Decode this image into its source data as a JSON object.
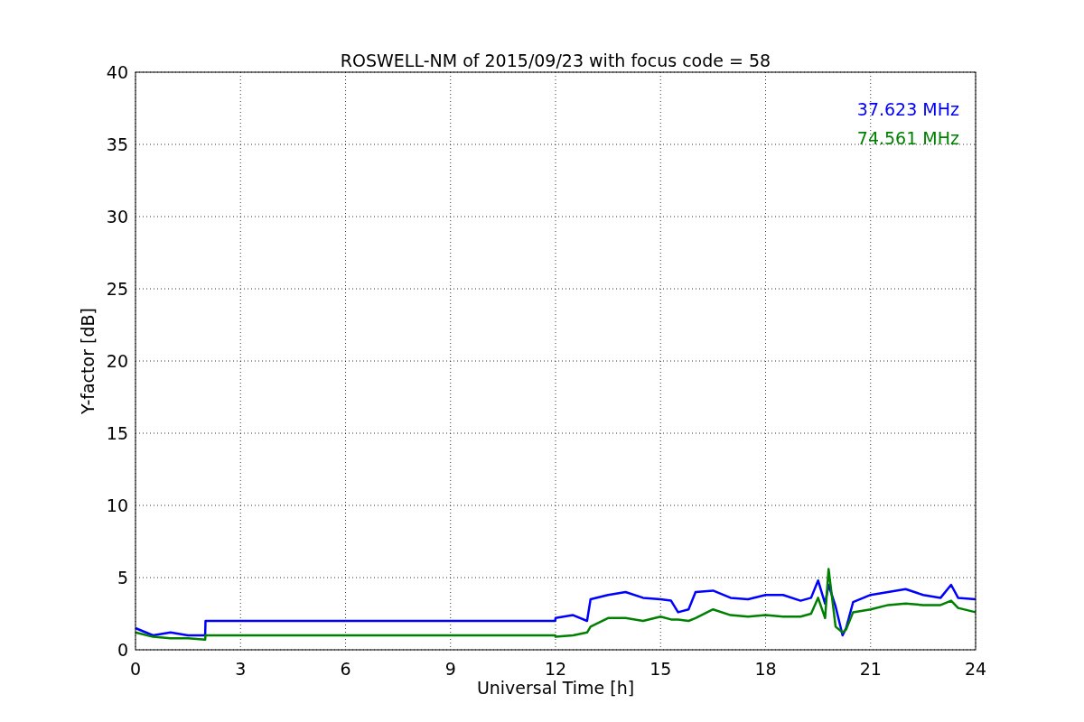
{
  "chart_data": {
    "type": "line",
    "title": "ROSWELL-NM of 2015/09/23 with focus code = 58",
    "xlabel": "Universal Time [h]",
    "ylabel": "Y-factor [dB]",
    "x": [
      0,
      0.5,
      1,
      1.5,
      1.99,
      2,
      6,
      11.99,
      12,
      12.5,
      12.9,
      13,
      13.5,
      14,
      14.5,
      15,
      15.3,
      15.5,
      15.8,
      16,
      16.5,
      17,
      17.5,
      18,
      18.5,
      19,
      19.3,
      19.5,
      19.7,
      19.8,
      20,
      20.2,
      20.3,
      20.5,
      21,
      21.5,
      22,
      22.5,
      23,
      23.3,
      23.5,
      24
    ],
    "series": [
      {
        "name": "37.623 MHz",
        "color": "#0000ff",
        "values": [
          1.5,
          1.0,
          1.2,
          1.0,
          1.0,
          2.0,
          2.0,
          2.0,
          2.2,
          2.4,
          2.0,
          3.5,
          3.8,
          4.0,
          3.6,
          3.5,
          3.4,
          2.6,
          2.8,
          4.0,
          4.1,
          3.6,
          3.5,
          3.8,
          3.8,
          3.4,
          3.6,
          4.8,
          3.2,
          4.5,
          3.0,
          1.0,
          1.5,
          3.3,
          3.8,
          4.0,
          4.2,
          3.8,
          3.6,
          4.5,
          3.6,
          3.5
        ]
      },
      {
        "name": "74.561 MHz",
        "color": "#008000",
        "values": [
          1.2,
          0.9,
          0.8,
          0.8,
          0.7,
          1.0,
          1.0,
          1.0,
          0.9,
          1.0,
          1.2,
          1.6,
          2.2,
          2.2,
          2.0,
          2.3,
          2.1,
          2.1,
          2.0,
          2.2,
          2.8,
          2.4,
          2.3,
          2.4,
          2.3,
          2.3,
          2.5,
          3.6,
          2.2,
          5.6,
          1.6,
          1.2,
          1.4,
          2.6,
          2.8,
          3.1,
          3.2,
          3.1,
          3.1,
          3.4,
          2.9,
          2.6
        ]
      }
    ],
    "grid": true,
    "xlim": [
      0,
      24
    ],
    "ylim": [
      0,
      40
    ],
    "xticks": [
      0,
      3,
      6,
      9,
      12,
      15,
      18,
      21,
      24
    ],
    "yticks": [
      0,
      5,
      10,
      15,
      20,
      25,
      30,
      35,
      40
    ]
  }
}
